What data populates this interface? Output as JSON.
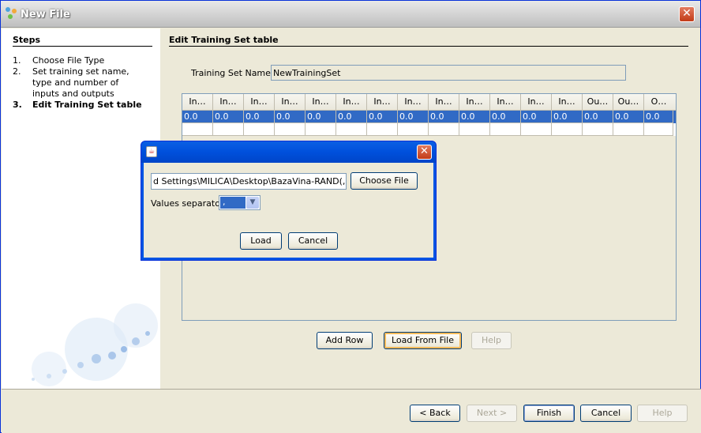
{
  "window": {
    "title": "New File",
    "close": "✕"
  },
  "steps": {
    "title": "Steps",
    "items": [
      {
        "num": "1.",
        "label": "Choose File Type"
      },
      {
        "num": "2.",
        "label": "Set training set name, type and number of inputs and outputs"
      },
      {
        "num": "3.",
        "label": "Edit Training Set table"
      }
    ]
  },
  "main": {
    "title": "Edit Training Set table",
    "ts_label": "Training Set Name:",
    "ts_value": "NewTrainingSet",
    "table": {
      "headers": [
        "In…",
        "In…",
        "In…",
        "In…",
        "In…",
        "In…",
        "In…",
        "In…",
        "In…",
        "In…",
        "In…",
        "In…",
        "In…",
        "Ou…",
        "Ou…",
        "O…"
      ],
      "row1": [
        "0.0",
        "0.0",
        "0.0",
        "0.0",
        "0.0",
        "0.0",
        "0.0",
        "0.0",
        "0.0",
        "0.0",
        "0.0",
        "0.0",
        "0.0",
        "0.0",
        "0.0",
        "0.0"
      ],
      "row2": [
        "",
        "",
        "",
        "",
        "",
        "",
        "",
        "",
        "",
        "",
        "",
        "",
        "",
        "",
        "",
        ""
      ]
    },
    "buttons": {
      "add_row": "Add Row",
      "load_from_file": "Load From File",
      "help": "Help"
    }
  },
  "footer": {
    "back": "< Back",
    "next": "Next >",
    "finish": "Finish",
    "cancel": "Cancel",
    "help": "Help"
  },
  "dialog": {
    "close": "✕",
    "file_path": "d Settings\\MILICA\\Desktop\\BazaVina-RAND(,).csv",
    "choose_file": "Choose File",
    "separator_label": "Values separator",
    "separator_value": ",",
    "load": "Load",
    "cancel": "Cancel"
  },
  "colors": {
    "selection": "#316ac5",
    "title_blue": "#0054e3",
    "panel": "#ece9d8"
  }
}
